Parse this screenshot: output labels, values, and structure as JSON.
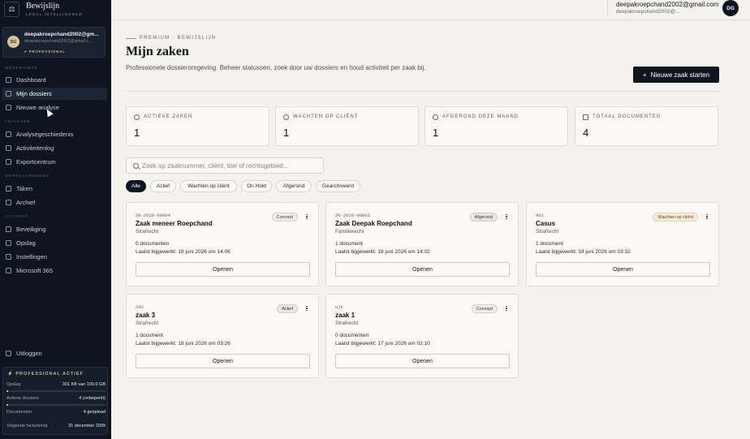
{
  "brand": {
    "name": "Bewijslijn",
    "tagline": "LEGAL INTELLIGENCE",
    "logo_icon": "scale-icon"
  },
  "user": {
    "initials": "DG",
    "name": "deepakroepchand2002@gm...",
    "email": "deepakroepchand2002@gmail.c...",
    "plan": "● PROFESSIONAL"
  },
  "sidebar": {
    "sections": {
      "werkruimte": "WERKRUIMTE",
      "analyses": "ANALYSES",
      "werkzaamheden": "WERKZAAMHEDEN",
      "account": "ACCOUNT"
    },
    "items": [
      {
        "label": "Dashboard",
        "icon": "grid-icon"
      },
      {
        "label": "Mijn dossiers",
        "icon": "folder-icon",
        "active": true
      },
      {
        "label": "Nieuwe analyse",
        "icon": "sparkle-icon"
      },
      {
        "label": "Analysegeschiedenis",
        "icon": "history-icon"
      },
      {
        "label": "Activiteitenlog",
        "icon": "activity-icon"
      },
      {
        "label": "Exportcentrum",
        "icon": "download-icon"
      },
      {
        "label": "Taken",
        "icon": "check-square-icon"
      },
      {
        "label": "Archief",
        "icon": "archive-icon"
      },
      {
        "label": "Beveiliging",
        "icon": "shield-icon"
      },
      {
        "label": "Opslag",
        "icon": "database-icon"
      },
      {
        "label": "Instellingen",
        "icon": "gear-icon"
      },
      {
        "label": "Microsoft 365",
        "icon": "microsoft-icon"
      }
    ],
    "logout": "Uitloggen"
  },
  "plan_box": {
    "title": "PROFESSIONAL ACTIEF",
    "rows": [
      {
        "label": "Opslag",
        "value": "301 KB van 100.0 GB",
        "fill": 0.01
      },
      {
        "label": "Actieve dossiers",
        "value": "4 (onbeperkt)",
        "fill": 0.02
      },
      {
        "label": "Documenten",
        "value": "4 geüpload"
      },
      {
        "label": "Volgende facturering",
        "value": "31 december 2099"
      }
    ]
  },
  "header": {
    "user_name": "deepakroepchand2002@gmail.com",
    "user_email": "deepakroepchand2002@...",
    "initials": "DG"
  },
  "main": {
    "kicker": "PREMIUM · BEWIJSLIJN",
    "title": "Mijn zaken",
    "description": "Professionele dossieromgeving. Beheer statussen, zoek door uw dossiers en houd activiteit per zaak bij.",
    "new_button": "Nieuwe zaak starten",
    "new_button_icon": "+"
  },
  "stats": [
    {
      "label": "ACTIEVE ZAKEN",
      "value": "1",
      "icon": "clock-icon"
    },
    {
      "label": "WACHTEN OP CLIËNT",
      "value": "1",
      "icon": "clock-icon"
    },
    {
      "label": "AFGEROND DEZE MAAND",
      "value": "1",
      "icon": "check-circle-icon"
    },
    {
      "label": "TOTAAL DOCUMENTEN",
      "value": "4",
      "icon": "document-icon"
    }
  ],
  "search": {
    "placeholder": "Zoek op zaaknummer, cliënt, titel of rechtsgebied..."
  },
  "filters": [
    "Alle",
    "Actief",
    "Wachten op cliënt",
    "On Hold",
    "Afgerond",
    "Gearchiveerd"
  ],
  "cases": [
    {
      "code": "ZK-2026-00004",
      "title": "Zaak meneer Roepchand",
      "area": "Strafrecht",
      "status": "Concept",
      "docs": "0 documenten",
      "updated": "Laatst bijgewerkt: 18 juni 2026 om 14:06",
      "open": "Openen"
    },
    {
      "code": "ZK-2026-00003",
      "title": "Zaak Deepak Roepchand",
      "area": "Familierecht",
      "status": "Afgerond",
      "docs": "1 document",
      "updated": "Laatst bijgewerkt: 18 juni 2026 om 14:02",
      "open": "Openen"
    },
    {
      "code": "001",
      "title": "Casus",
      "area": "Strafrecht",
      "status": "Wachten op cliënt",
      "docs": "1 document",
      "updated": "Laatst bijgewerkt: 18 juni 2026 om 03:32",
      "open": "Openen"
    },
    {
      "code": "242",
      "title": "zaak 3",
      "area": "Strafrecht",
      "status": "Actief",
      "docs": "1 document",
      "updated": "Laatst bijgewerkt: 18 juni 2026 om 03:26",
      "open": "Openen"
    },
    {
      "code": "ujk",
      "title": "zaak 1",
      "area": "Strafrecht",
      "status": "Concept",
      "docs": "0 documenten",
      "updated": "Laatst bijgewerkt: 17 juni 2026 om 02:10",
      "open": "Openen"
    }
  ]
}
